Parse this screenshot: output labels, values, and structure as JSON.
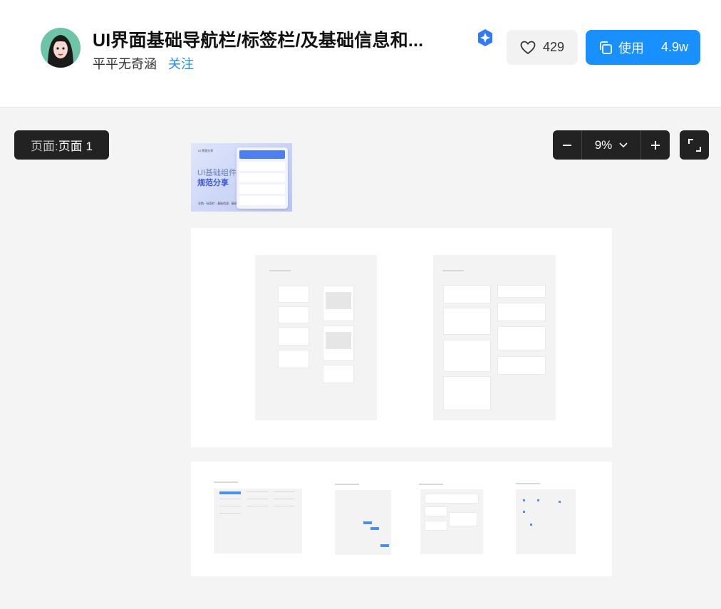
{
  "header": {
    "title": "UI界面基础导航栏/标签栏/及基础信息和...",
    "author": "平平无奇涵",
    "follow_label": "关注",
    "like_count": "429",
    "use_label": "使用",
    "use_count": "4.9w"
  },
  "canvas": {
    "page_prefix": "页面: ",
    "page_name": "页面 1",
    "zoom": "9%"
  },
  "cover": {
    "tag": "UI 界面分享",
    "line1": "UI基础组件",
    "line2": "规范分享",
    "footer": "导航 · 标签栏 · 基础信息 · 基础信息"
  },
  "colors": {
    "accent": "#1890ff",
    "dark_chip": "#222222"
  }
}
